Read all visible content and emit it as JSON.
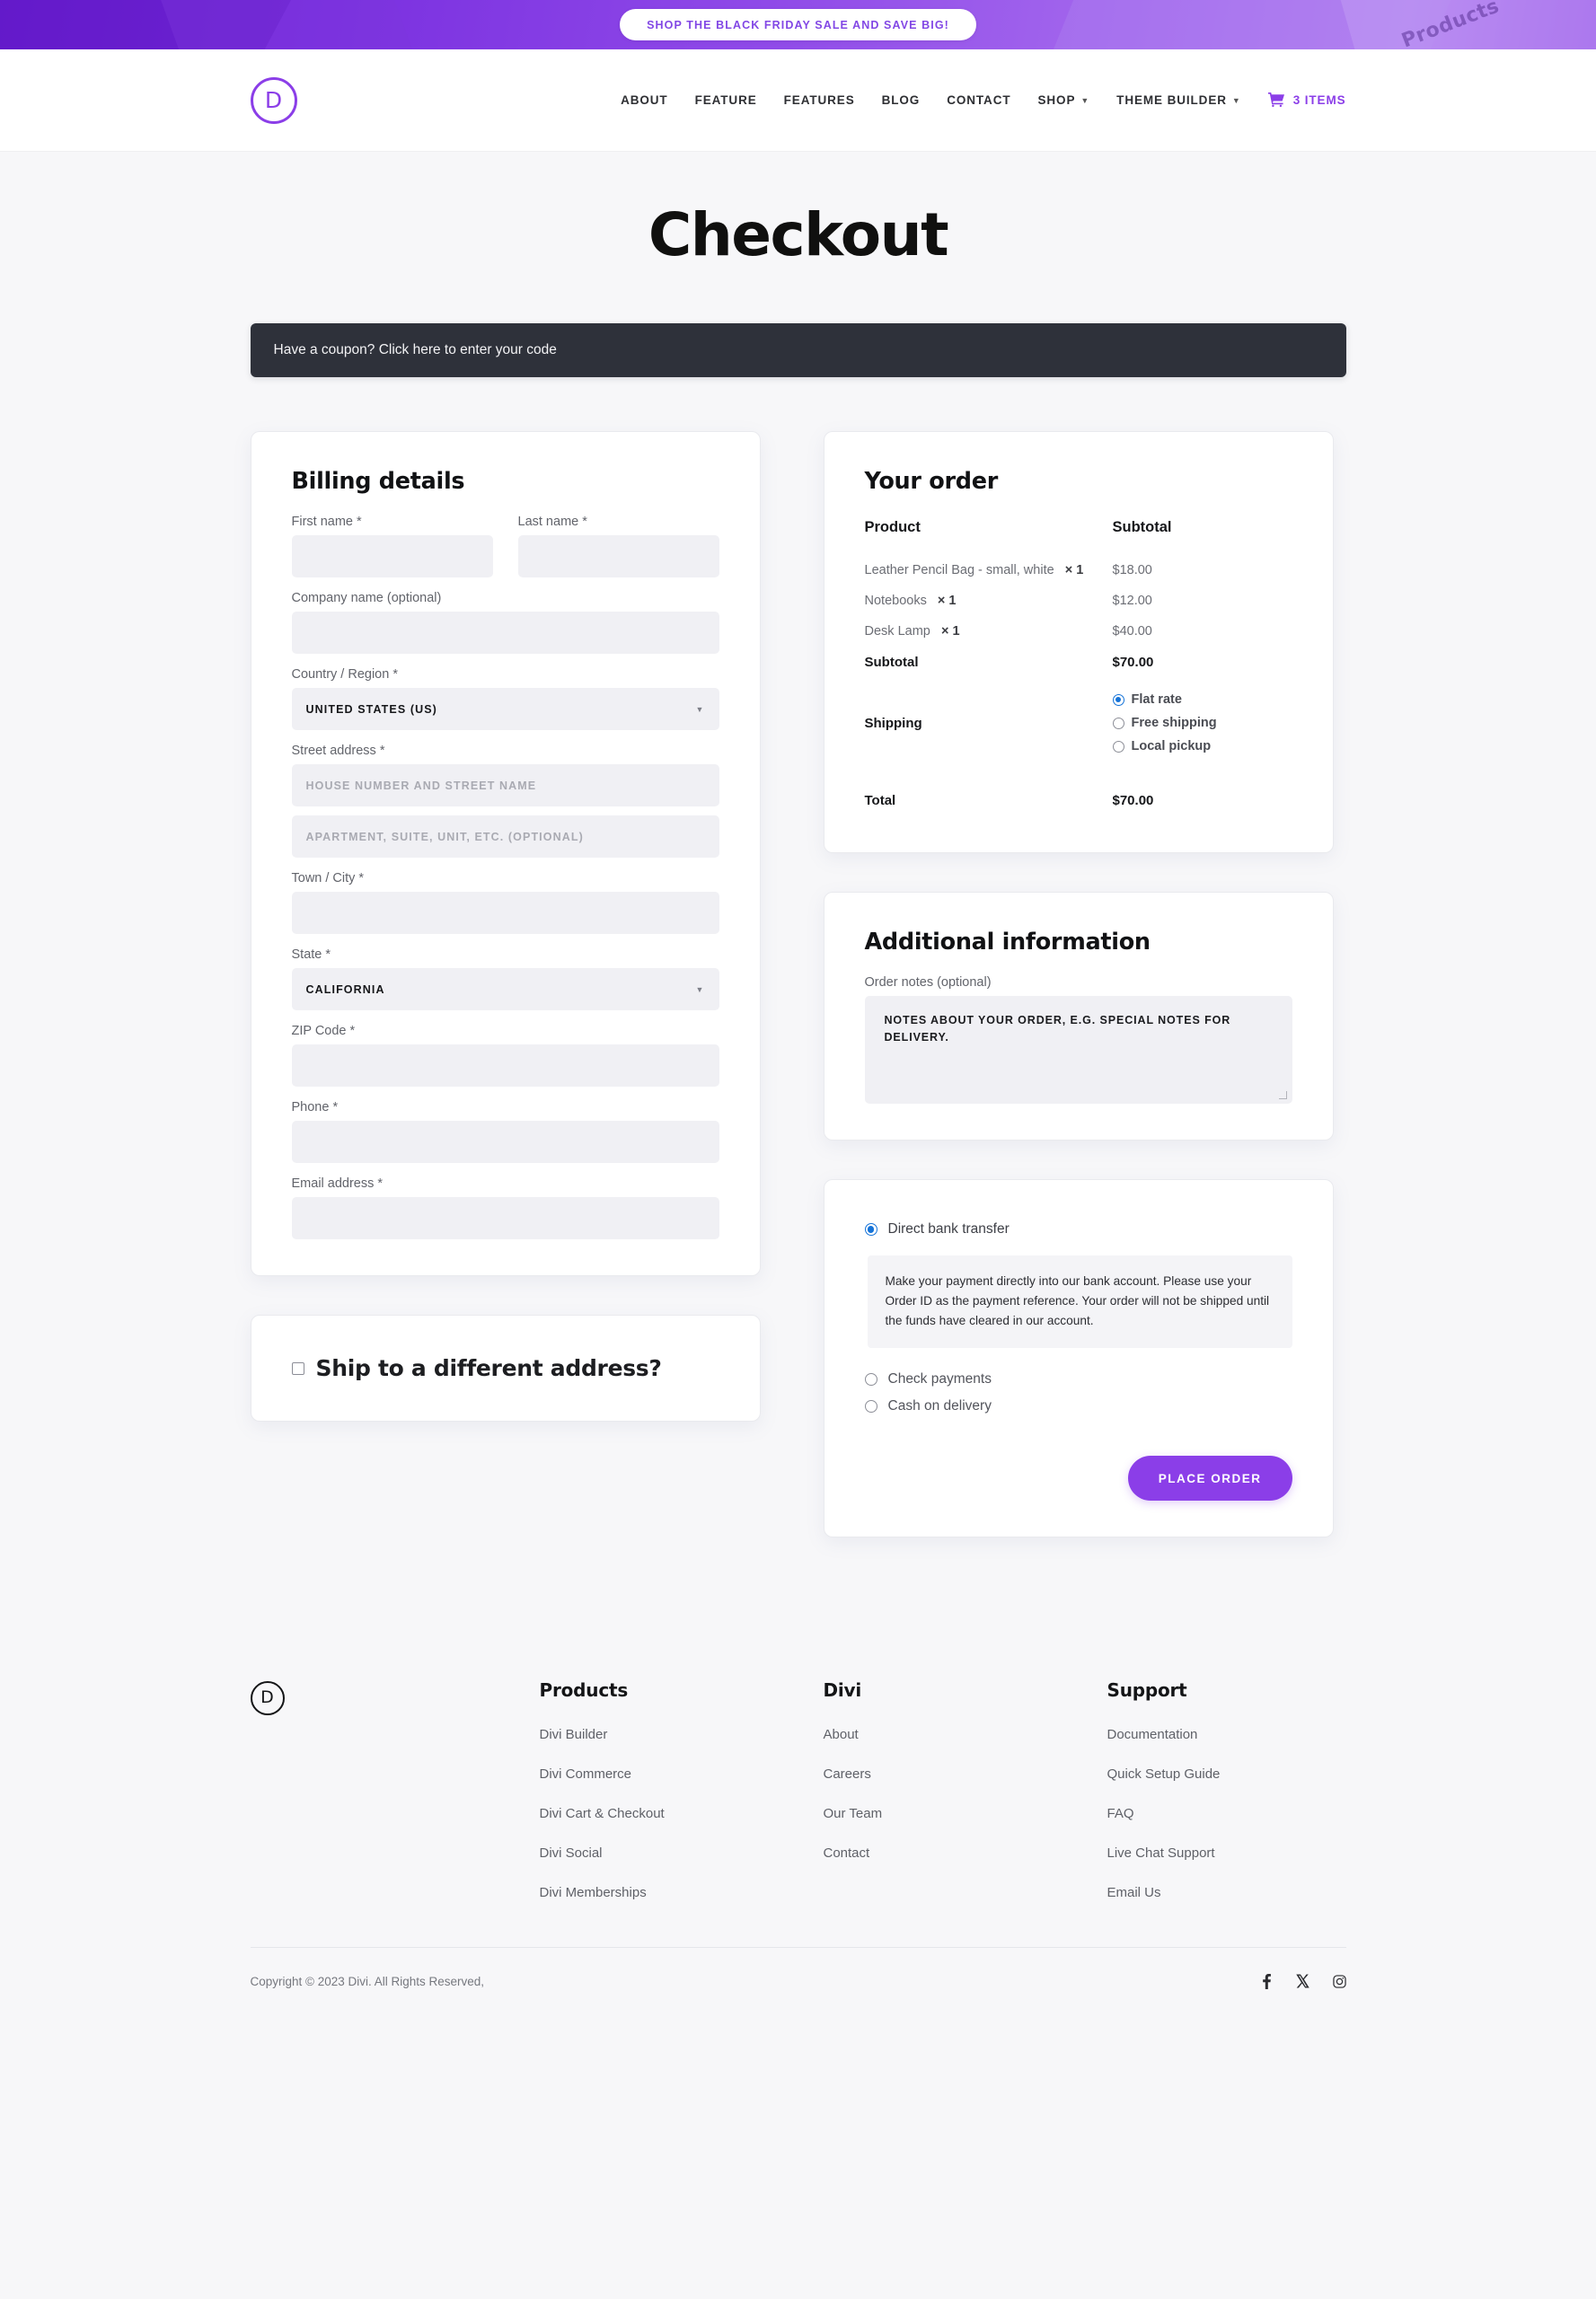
{
  "announcement": {
    "button_label": "SHOP THE BLACK FRIDAY SALE AND SAVE BIG!",
    "watermark": "Products",
    "bg_start": "#6b1fd4",
    "bg_end": "#b27ef0"
  },
  "header": {
    "logo_letter": "D",
    "nav": [
      {
        "label": "ABOUT",
        "has_caret": false
      },
      {
        "label": "FEATURE",
        "has_caret": false
      },
      {
        "label": "FEATURES",
        "has_caret": false
      },
      {
        "label": "BLOG",
        "has_caret": false
      },
      {
        "label": "CONTACT",
        "has_caret": false
      },
      {
        "label": "SHOP",
        "has_caret": true
      },
      {
        "label": "THEME BUILDER",
        "has_caret": true
      }
    ],
    "cart": {
      "label": "3 ITEMS",
      "icon": "shopping-cart-icon"
    },
    "accent_color": "#8b3ee8"
  },
  "page": {
    "title": "Checkout",
    "coupon_notice": "Have a coupon? Click here to enter your code"
  },
  "billing": {
    "title": "Billing details",
    "first_name": {
      "label": "First name *",
      "value": ""
    },
    "last_name": {
      "label": "Last name *",
      "value": ""
    },
    "company": {
      "label": "Company name (optional)",
      "value": ""
    },
    "country": {
      "label": "Country / Region *",
      "value": "UNITED STATES (US)"
    },
    "street": {
      "label": "Street address *",
      "placeholder1": "HOUSE NUMBER AND STREET NAME",
      "placeholder2": "APARTMENT, SUITE, UNIT, ETC. (OPTIONAL)"
    },
    "city": {
      "label": "Town / City *",
      "value": ""
    },
    "state": {
      "label": "State *",
      "value": "CALIFORNIA"
    },
    "zip": {
      "label": "ZIP Code *",
      "value": ""
    },
    "phone": {
      "label": "Phone *",
      "value": ""
    },
    "email": {
      "label": "Email address *",
      "value": ""
    }
  },
  "ship_different": {
    "label": "Ship to a different address?",
    "checked": false
  },
  "order": {
    "title": "Your order",
    "col_product": "Product",
    "col_subtotal": "Subtotal",
    "items": [
      {
        "name": "Leather Pencil Bag - small, white",
        "qty": "1",
        "price": "$18.00"
      },
      {
        "name": "Notebooks",
        "qty": "1",
        "price": "$12.00"
      },
      {
        "name": "Desk Lamp",
        "qty": "1",
        "price": "$40.00"
      }
    ],
    "subtotal_label": "Subtotal",
    "subtotal_value": "$70.00",
    "shipping_label": "Shipping",
    "shipping_options": [
      {
        "label": "Flat rate",
        "selected": true
      },
      {
        "label": "Free shipping",
        "selected": false
      },
      {
        "label": "Local pickup",
        "selected": false
      }
    ],
    "total_label": "Total",
    "total_value": "$70.00",
    "radio_accent": "#1573d8"
  },
  "additional": {
    "title": "Additional information",
    "notes_label": "Order notes (optional)",
    "notes_placeholder": "NOTES ABOUT YOUR ORDER, E.G. SPECIAL NOTES FOR DELIVERY."
  },
  "payment": {
    "methods": [
      {
        "label": "Direct bank transfer",
        "selected": true
      },
      {
        "label": "Check payments",
        "selected": false
      },
      {
        "label": "Cash on delivery",
        "selected": false
      }
    ],
    "description": "Make your payment directly into our bank account. Please use your Order ID as the payment reference. Your order will not be shipped until the funds have cleared in our account.",
    "place_order_label": "PLACE ORDER",
    "button_color": "#8b3ee8"
  },
  "footer": {
    "logo_letter": "D",
    "columns": [
      {
        "heading": "Products",
        "links": [
          "Divi Builder",
          "Divi Commerce",
          "Divi Cart & Checkout",
          "Divi Social",
          "Divi Memberships"
        ]
      },
      {
        "heading": "Divi",
        "links": [
          "About",
          "Careers",
          "Our Team",
          "Contact"
        ]
      },
      {
        "heading": "Support",
        "links": [
          "Documentation",
          "Quick Setup Guide",
          "FAQ",
          "Live Chat Support",
          "Email Us"
        ]
      }
    ],
    "copyright": "Copyright © 2023 Divi. All Rights Reserved,",
    "socials": [
      "facebook-icon",
      "x-twitter-icon",
      "instagram-icon"
    ]
  }
}
